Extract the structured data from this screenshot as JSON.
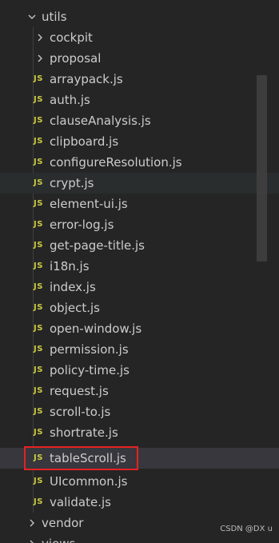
{
  "tree": {
    "utils_folder": "utils",
    "subfolders": [
      "cockpit",
      "proposal"
    ],
    "file_icon_label": "JS",
    "files": [
      "arraypack.js",
      "auth.js",
      "clauseAnalysis.js",
      "clipboard.js",
      "configureResolution.js",
      "crypt.js",
      "element-ui.js",
      "error-log.js",
      "get-page-title.js",
      "i18n.js",
      "index.js",
      "object.js",
      "open-window.js",
      "permission.js",
      "policy-time.js",
      "request.js",
      "scroll-to.js",
      "shortrate.js",
      "tableScroll.js",
      "UIcommon.js",
      "validate.js"
    ],
    "hovered_file": "crypt.js",
    "selected_file": "tableScroll.js",
    "vendor_folder": "vendor",
    "views_folder_partial": "views"
  },
  "watermark": "CSDN @DX u",
  "colors": {
    "background": "#252526",
    "text": "#cccccc",
    "js_icon": "#cbcb41",
    "highlight": "#e52222",
    "selected_row": "#37373d"
  }
}
